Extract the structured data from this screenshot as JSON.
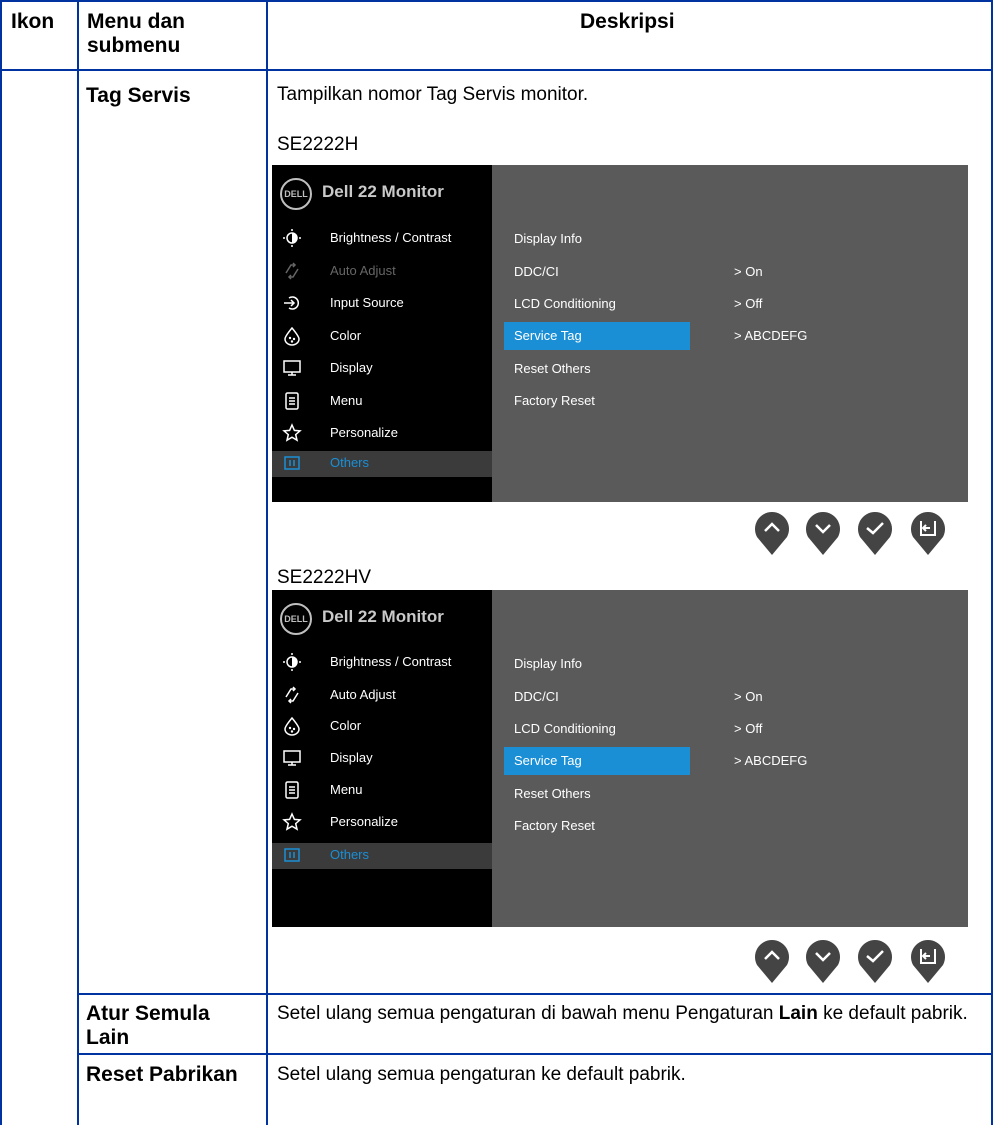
{
  "table": {
    "headers": {
      "icon": "Ikon",
      "menu": "Menu dan submenu",
      "description": "Deskripsi"
    },
    "rows": [
      {
        "menu": "Tag Servis",
        "description": "Tampilkan nomor Tag Servis monitor."
      },
      {
        "menu": "Atur Semula Lain",
        "description_pre": "Setel ulang semua pengaturan di bawah menu Pengaturan ",
        "description_bold": "Lain",
        "description_post": " ke default pabrik."
      },
      {
        "menu": "Reset Pabrikan",
        "description": "Setel ulang semua pengaturan ke default pabrik."
      }
    ]
  },
  "osd_screens": [
    {
      "model": "SE2222H",
      "brand": "DELL",
      "title": "Dell 22 Monitor",
      "menu": [
        {
          "label": "Brightness / Contrast",
          "icon": "brightness-icon",
          "state": "normal"
        },
        {
          "label": "Auto Adjust",
          "icon": "auto-adjust-icon",
          "state": "dim"
        },
        {
          "label": "Input Source",
          "icon": "input-source-icon",
          "state": "normal"
        },
        {
          "label": "Color",
          "icon": "color-icon",
          "state": "normal"
        },
        {
          "label": "Display",
          "icon": "display-icon",
          "state": "normal"
        },
        {
          "label": "Menu",
          "icon": "menu-icon",
          "state": "normal"
        },
        {
          "label": "Personalize",
          "icon": "star-icon",
          "state": "normal"
        },
        {
          "label": "Others",
          "icon": "others-icon",
          "state": "selected"
        }
      ],
      "submenu": [
        {
          "label": "Display Info",
          "value": ""
        },
        {
          "label": "DDC/CI",
          "value": ">  On"
        },
        {
          "label": "LCD Conditioning",
          "value": ">  Off"
        },
        {
          "label": "Service Tag",
          "value": ">  ABCDEFG",
          "selected": true
        },
        {
          "label": "Reset Others",
          "value": ""
        },
        {
          "label": "Factory Reset",
          "value": ""
        }
      ]
    },
    {
      "model": "SE2222HV",
      "brand": "DELL",
      "title": "Dell 22 Monitor",
      "menu": [
        {
          "label": "Brightness / Contrast",
          "icon": "brightness-icon",
          "state": "normal"
        },
        {
          "label": "Auto Adjust",
          "icon": "auto-adjust-icon",
          "state": "normal"
        },
        {
          "label": "Color",
          "icon": "color-icon",
          "state": "normal"
        },
        {
          "label": "Display",
          "icon": "display-icon",
          "state": "normal"
        },
        {
          "label": "Menu",
          "icon": "menu-icon",
          "state": "normal"
        },
        {
          "label": "Personalize",
          "icon": "star-icon",
          "state": "normal"
        },
        {
          "label": "Others",
          "icon": "others-icon",
          "state": "selected"
        }
      ],
      "submenu": [
        {
          "label": "Display Info",
          "value": ""
        },
        {
          "label": "DDC/CI",
          "value": ">  On"
        },
        {
          "label": "LCD Conditioning",
          "value": ">  Off"
        },
        {
          "label": "Service Tag",
          "value": ">  ABCDEFG",
          "selected": true
        },
        {
          "label": "Reset Others",
          "value": ""
        },
        {
          "label": "Factory Reset",
          "value": ""
        }
      ]
    }
  ],
  "nav_buttons": [
    "up-icon",
    "down-icon",
    "check-icon",
    "back-icon"
  ],
  "colors": {
    "table_border": "#0033a0",
    "osd_highlight": "#1a8fd6",
    "osd_panel": "#5a5a5a",
    "nav_button": "#444444"
  }
}
